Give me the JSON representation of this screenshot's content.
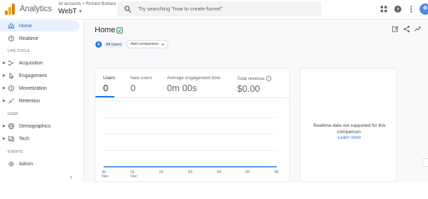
{
  "header": {
    "app_title": "Analytics",
    "account_path": "All accounts > Richard Bishara",
    "property_name": "WebT",
    "search_placeholder": "Try searching \"how to create funnel\""
  },
  "sidebar": {
    "items": [
      {
        "label": "Home",
        "icon": "home-icon",
        "active": true
      },
      {
        "label": "Realtime",
        "icon": "realtime-icon"
      }
    ],
    "sections": [
      {
        "label": "LIFE CYCLE",
        "items": [
          {
            "label": "Acquisition",
            "icon": "acquisition-icon"
          },
          {
            "label": "Engagement",
            "icon": "engagement-icon"
          },
          {
            "label": "Monetization",
            "icon": "monetization-icon"
          },
          {
            "label": "Retention",
            "icon": "retention-icon"
          }
        ]
      },
      {
        "label": "USER",
        "items": [
          {
            "label": "Demographics",
            "icon": "globe-icon"
          },
          {
            "label": "Tech",
            "icon": "tech-icon"
          }
        ]
      },
      {
        "label": "EVENTS",
        "items": [
          {
            "label": "Admin",
            "icon": "gear-icon"
          }
        ]
      }
    ],
    "collapse_glyph": "‹"
  },
  "main": {
    "title": "Home",
    "segment_letter": "A",
    "segment_label": "All Users",
    "add_comparison": "Add comparison",
    "metrics": [
      {
        "label": "Users",
        "value": "0",
        "active": true
      },
      {
        "label": "New users",
        "value": "0"
      },
      {
        "label": "Average engagement time",
        "value": "0m 00s"
      },
      {
        "label": "Total revenue",
        "value": "$0.00",
        "has_info": true
      }
    ],
    "unsupported_text": "Realtime data not supported for this comparison.",
    "learn_more": "Learn more"
  },
  "chart_data": {
    "type": "line",
    "x": [
      "30 Nov",
      "01 Dec",
      "02",
      "03",
      "04",
      "05",
      "06"
    ],
    "tick_top": [
      "30",
      "01",
      "02",
      "03",
      "04",
      "05",
      "06"
    ],
    "tick_bottom": [
      "Nov",
      "Dec",
      "",
      "",
      "",
      "",
      ""
    ],
    "series": [
      {
        "values": [
          0,
          0,
          0,
          0,
          0,
          0,
          0
        ]
      }
    ],
    "grid": true,
    "colors": {
      "line": "#1a73e8",
      "grid": "#e8eaed"
    }
  }
}
